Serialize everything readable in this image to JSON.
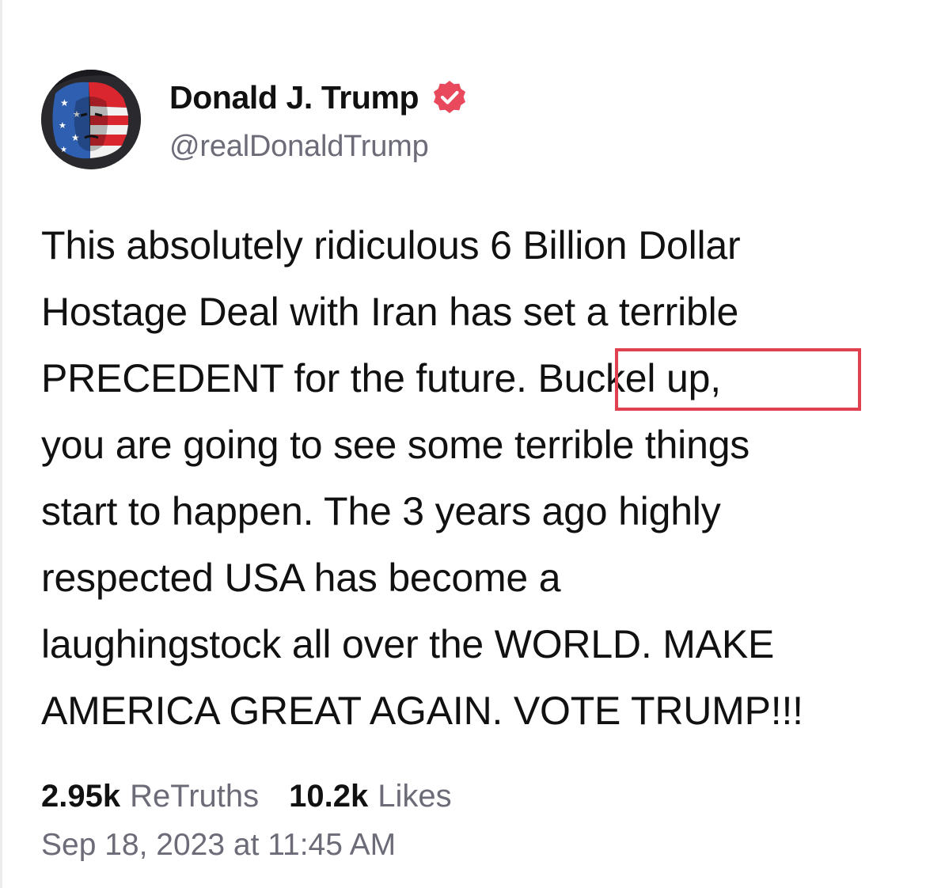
{
  "author": {
    "display_name": "Donald J. Trump",
    "handle": "@realDonaldTrump",
    "verified_color": "#e8495c",
    "avatar_icon": "portrait-flag-avatar"
  },
  "post": {
    "lines": [
      "This absolutely ridiculous 6 Billion Dollar",
      "Hostage Deal with Iran has set a terrible",
      "PRECEDENT for the future. Buckel up,",
      "you are going to see some terrible things",
      "start to happen. The 3 years ago highly",
      "respected USA has become a",
      "laughingstock all over the WORLD. MAKE",
      "AMERICA GREAT AGAIN. VOTE TRUMP!!!"
    ],
    "highlighted_phrase": "Buckel up,",
    "highlight_color": "#e0414f"
  },
  "stats": {
    "retruths_count": "2.95k",
    "retruths_label": "ReTruths",
    "likes_count": "10.2k",
    "likes_label": "Likes"
  },
  "timestamp": "Sep 18, 2023 at 11:45 AM"
}
